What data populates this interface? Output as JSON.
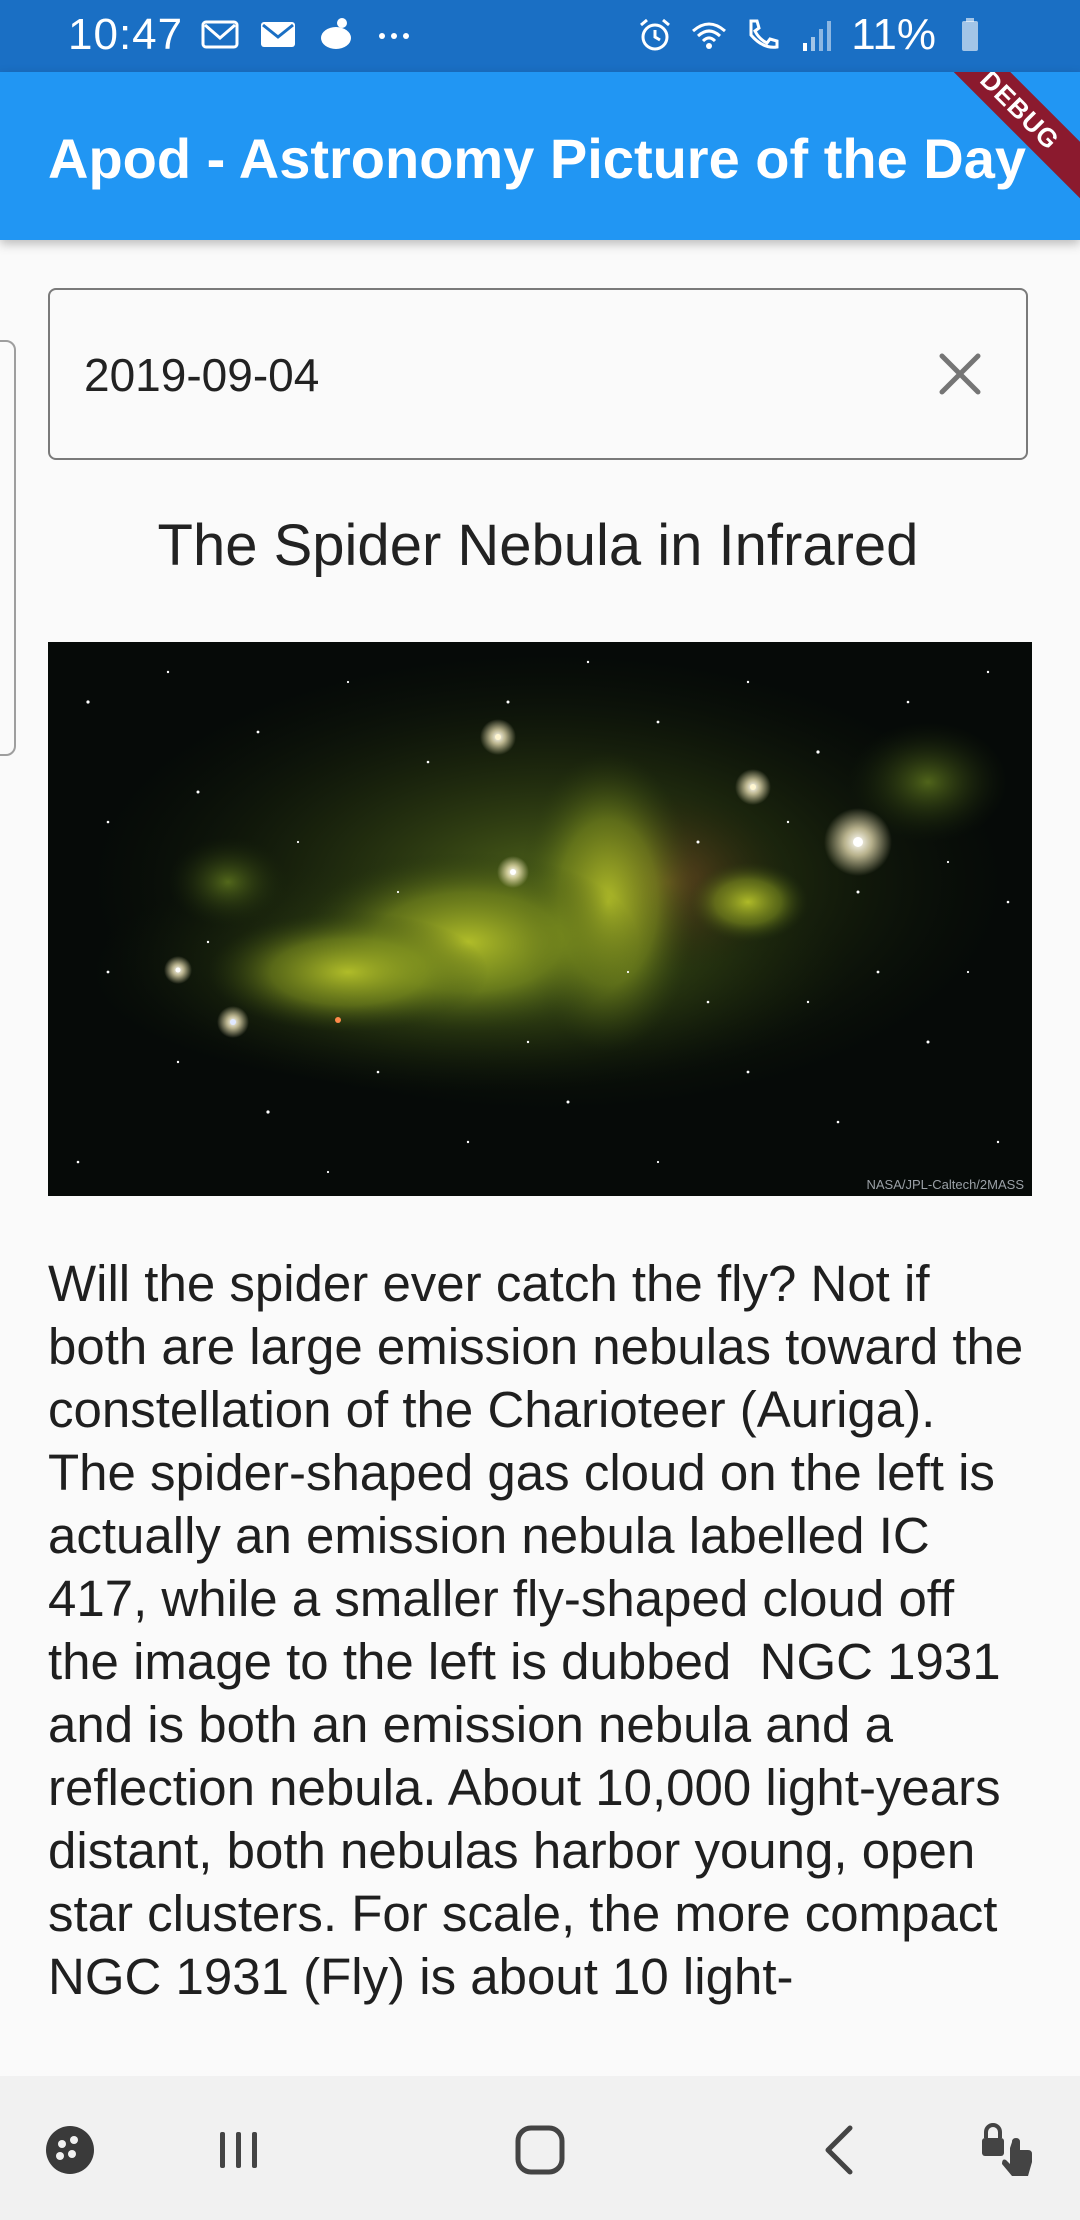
{
  "status_bar": {
    "time": "10:47",
    "left_icons": [
      "gmail-icon",
      "mail-icon",
      "notification-app-icon",
      "more-dots-icon"
    ],
    "right_icons": [
      "alarm-icon",
      "wifi-icon",
      "wifi-calling-icon",
      "signal-icon",
      "battery-icon"
    ],
    "battery_percent": "11%"
  },
  "app_bar": {
    "title": "Apod - Astronomy Picture of the Day",
    "debug_badge": "DEBUG",
    "color": "#2196f3"
  },
  "date_input": {
    "value": "2019-09-04",
    "clear_icon": "close-icon"
  },
  "apod": {
    "title": "The Spider Nebula in Infrared",
    "image_credit": "NASA/JPL-Caltech/2MASS",
    "explanation": "Will the spider ever catch the fly? Not if both are large emission nebulas toward the constellation of the Charioteer (Auriga).  The spider-shaped gas cloud on the left is actually an emission nebula labelled IC 417, while a smaller fly-shaped cloud off the image to the left is dubbed  NGC 1931 and is both an emission nebula and a reflection nebula. About 10,000 light-years distant, both nebulas harbor young, open star clusters. For scale, the more compact NGC 1931 (Fly) is about 10 light-"
  },
  "nav_bar": {
    "buttons": [
      "game-launcher-icon",
      "recent-apps-icon",
      "home-icon",
      "back-icon",
      "touch-lock-icon"
    ]
  }
}
